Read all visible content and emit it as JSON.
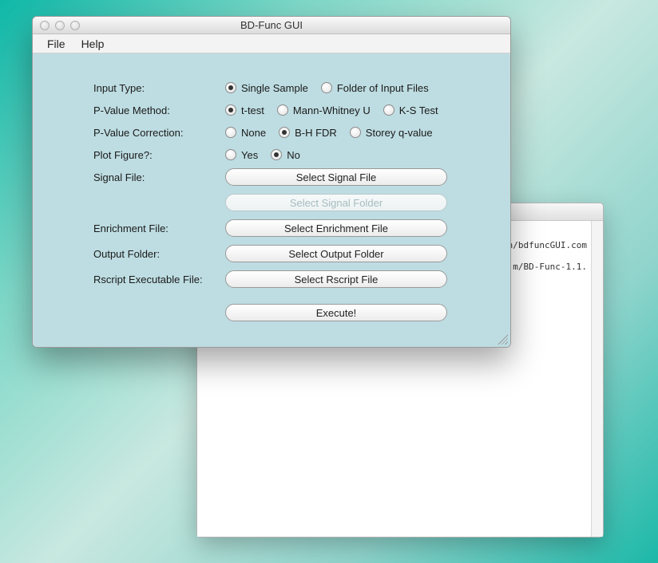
{
  "background_window": {
    "lines": [
      "n/bdfuncGUI.com",
      "m/BD-Func-1.1."
    ]
  },
  "window": {
    "title": "BD-Func GUI",
    "menu": {
      "file": "File",
      "help": "Help"
    }
  },
  "form": {
    "labels": {
      "input_type": "Input Type:",
      "pvalue_method": "P-Value Method:",
      "pvalue_correction": "P-Value Correction:",
      "plot_figure": "Plot Figure?:",
      "signal_file": "Signal File:",
      "enrichment_file": "Enrichment File:",
      "output_folder": "Output Folder:",
      "rscript_file": "Rscript Executable File:"
    },
    "input_type": {
      "options": [
        "Single Sample",
        "Folder of Input Files"
      ],
      "selected": "Single Sample"
    },
    "pvalue_method": {
      "options": [
        "t-test",
        "Mann-Whitney U",
        "K-S Test"
      ],
      "selected": "t-test"
    },
    "pvalue_correction": {
      "options": [
        "None",
        "B-H FDR",
        "Storey q-value"
      ],
      "selected": "B-H FDR"
    },
    "plot_figure": {
      "options": [
        "Yes",
        "No"
      ],
      "selected": "No"
    },
    "buttons": {
      "select_signal_file": "Select Signal File",
      "select_signal_folder": "Select Signal Folder",
      "select_enrichment_file": "Select Enrichment File",
      "select_output_folder": "Select Output Folder",
      "select_rscript_file": "Select Rscript File",
      "execute": "Execute!"
    }
  }
}
